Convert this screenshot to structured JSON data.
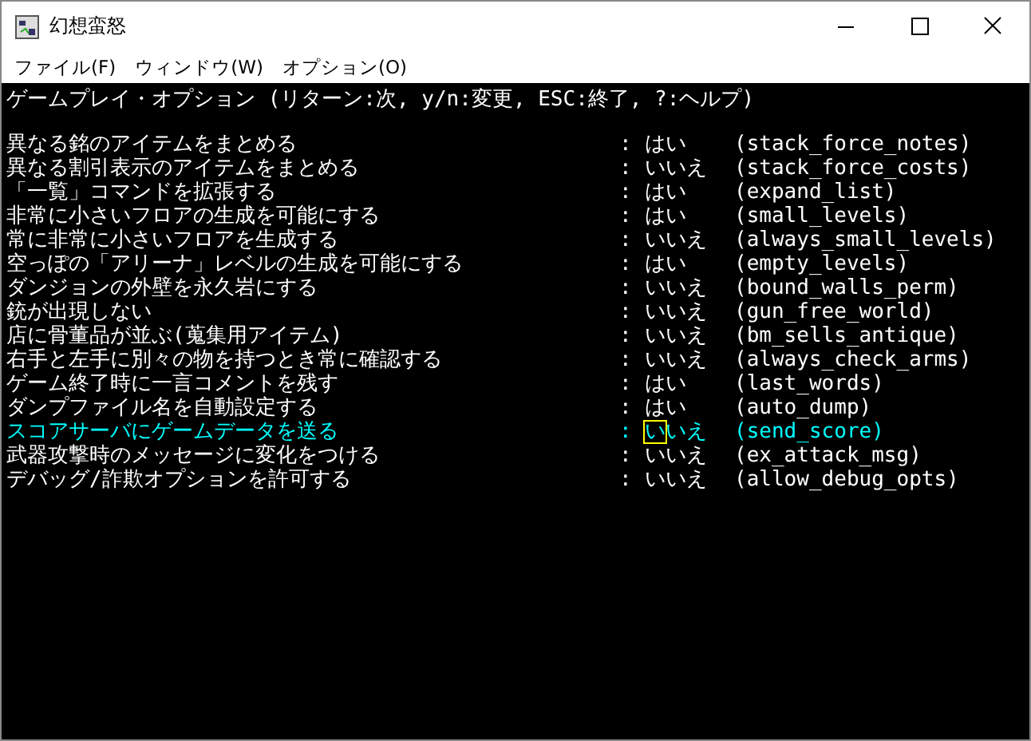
{
  "window": {
    "title": "幻想蛮怒"
  },
  "menu": [
    "ファイル(F)",
    "ウィンドウ(W)",
    "オプション(O)"
  ],
  "header": "ゲームプレイ・オプション (リターン:次, y/n:変更, ESC:終了, ?:ヘルプ)",
  "options": [
    {
      "label": "異なる銘のアイテムをまとめる",
      "separator": ":",
      "value": "はい",
      "key": "(stack_force_notes)",
      "selected": false
    },
    {
      "label": "異なる割引表示のアイテムをまとめる",
      "separator": ":",
      "value": "いいえ",
      "key": "(stack_force_costs)",
      "selected": false
    },
    {
      "label": "「一覧」コマンドを拡張する",
      "separator": ":",
      "value": "はい",
      "key": "(expand_list)",
      "selected": false
    },
    {
      "label": "非常に小さいフロアの生成を可能にする",
      "separator": ":",
      "value": "はい",
      "key": "(small_levels)",
      "selected": false
    },
    {
      "label": "常に非常に小さいフロアを生成する",
      "separator": ":",
      "value": "いいえ",
      "key": "(always_small_levels)",
      "selected": false
    },
    {
      "label": "空っぽの「アリーナ」レベルの生成を可能にする",
      "separator": ":",
      "value": "はい",
      "key": "(empty_levels)",
      "selected": false
    },
    {
      "label": "ダンジョンの外壁を永久岩にする",
      "separator": ":",
      "value": "いいえ",
      "key": "(bound_walls_perm)",
      "selected": false
    },
    {
      "label": "銃が出現しない",
      "separator": ":",
      "value": "いいえ",
      "key": "(gun_free_world)",
      "selected": false
    },
    {
      "label": "店に骨董品が並ぶ(蒐集用アイテム)",
      "separator": ":",
      "value": "いいえ",
      "key": "(bm_sells_antique)",
      "selected": false
    },
    {
      "label": "右手と左手に別々の物を持つとき常に確認する",
      "separator": ":",
      "value": "いいえ",
      "key": "(always_check_arms)",
      "selected": false
    },
    {
      "label": "ゲーム終了時に一言コメントを残す",
      "separator": ":",
      "value": "はい",
      "key": "(last_words)",
      "selected": false
    },
    {
      "label": "ダンプファイル名を自動設定する",
      "separator": ":",
      "value": "はい",
      "key": "(auto_dump)",
      "selected": false
    },
    {
      "label": "スコアサーバにゲームデータを送る",
      "separator": ":",
      "value": "いいえ",
      "key": "(send_score)",
      "selected": true
    },
    {
      "label": "武器攻撃時のメッセージに変化をつける",
      "separator": ":",
      "value": "いいえ",
      "key": "(ex_attack_msg)",
      "selected": false
    },
    {
      "label": "デバッグ/詐欺オプションを許可する",
      "separator": ":",
      "value": "いいえ",
      "key": "(allow_debug_opts)",
      "selected": false
    }
  ]
}
